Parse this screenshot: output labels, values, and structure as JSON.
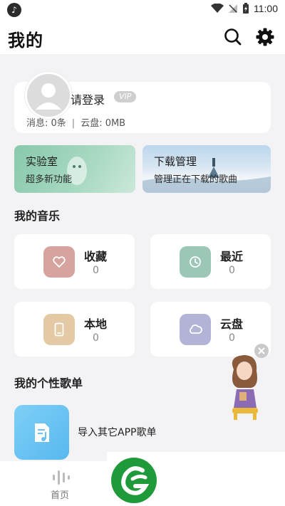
{
  "header": {
    "title": "我的"
  },
  "status_bar": {
    "time": "11:00"
  },
  "user": {
    "login_text": "请登录",
    "vip_label": "VIP",
    "messages": "消息: 0条",
    "cloud": "云盘: 0MB"
  },
  "promos": [
    {
      "title": "实验室",
      "subtitle": "超多新功能"
    },
    {
      "title": "下载管理",
      "subtitle": "管理正在下载的歌曲"
    }
  ],
  "my_music": {
    "title": "我的音乐",
    "tiles": [
      {
        "label": "收藏",
        "count": "0",
        "icon": "heart-icon",
        "color": "#d6a39e"
      },
      {
        "label": "最近",
        "count": "0",
        "icon": "clock-icon",
        "color": "#9cc7b7"
      },
      {
        "label": "本地",
        "count": "0",
        "icon": "phone-icon",
        "color": "#e3c9a4"
      },
      {
        "label": "云盘",
        "count": "0",
        "icon": "cloud-icon",
        "color": "#b3b3d7"
      }
    ]
  },
  "playlists": {
    "title": "我的个性歌单",
    "import_label": "导入其它APP歌单"
  },
  "bottom_nav": {
    "home_label": "首页"
  }
}
